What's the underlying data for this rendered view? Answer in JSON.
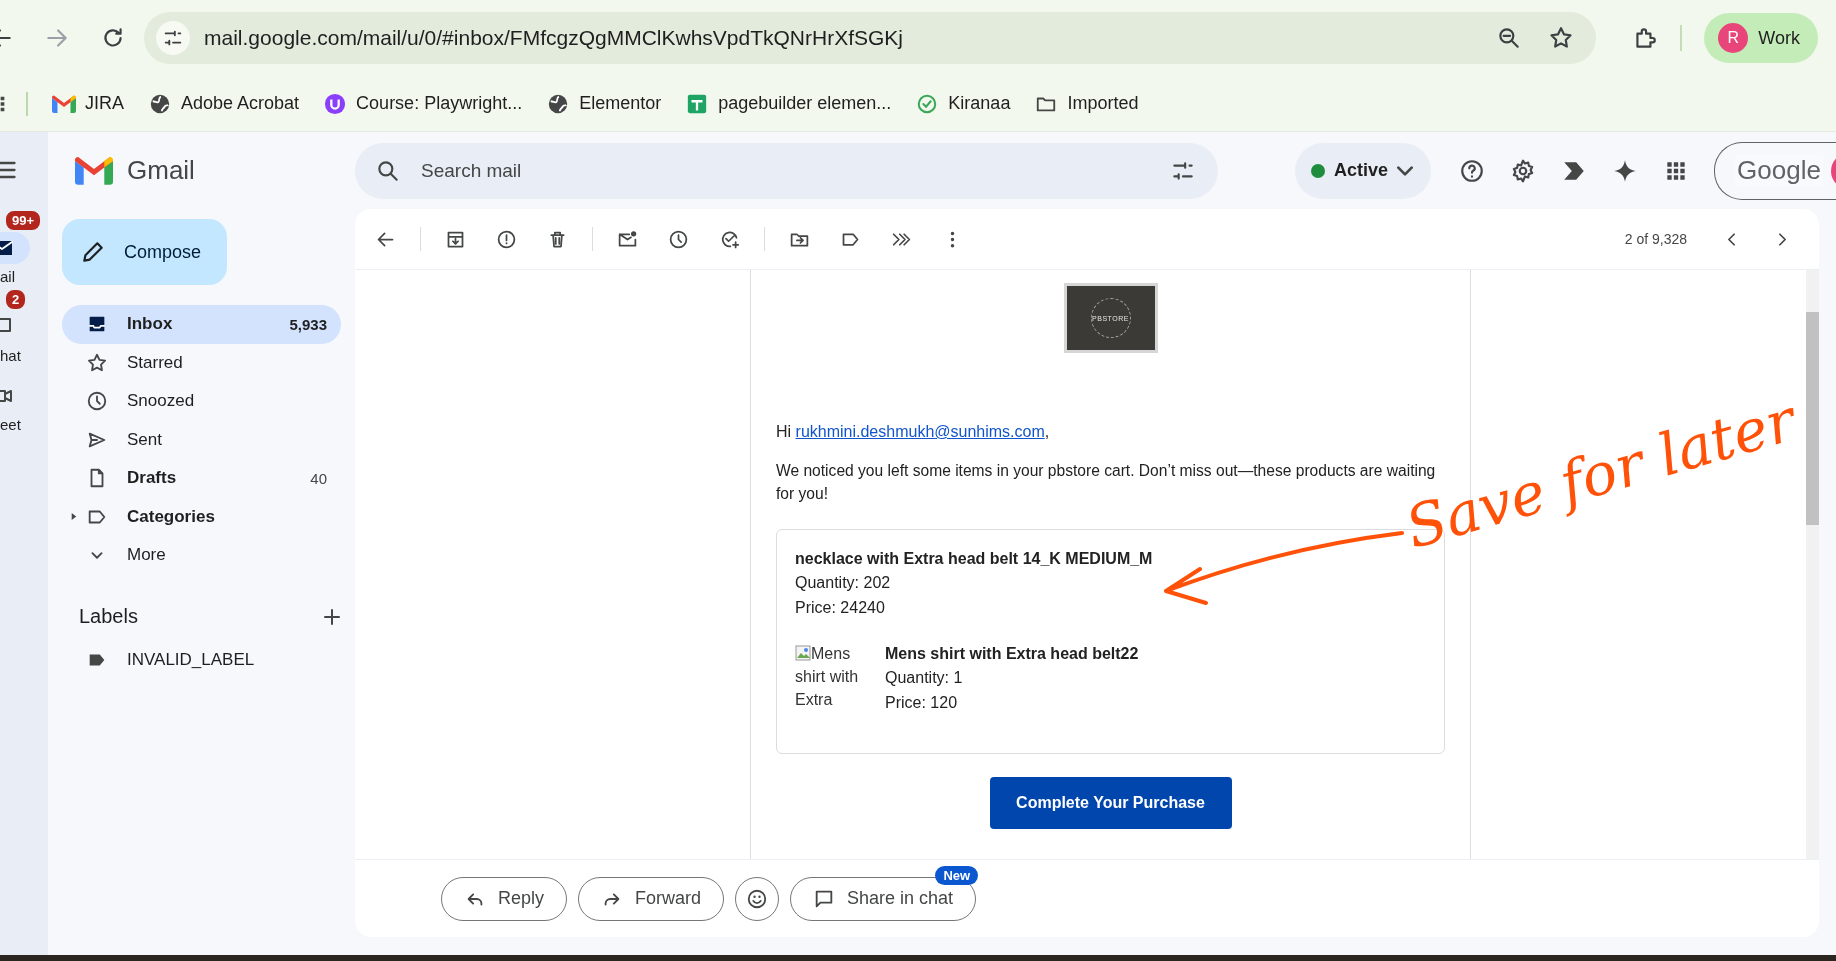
{
  "browser": {
    "url": "mail.google.com/mail/u/0/#inbox/FMfcgzQgMMClKwhsVpdTkQNrHrXfSGKj",
    "profile": {
      "initial": "R",
      "label": "Work"
    }
  },
  "bookmarks": [
    {
      "label": "JIRA",
      "kind": "mail"
    },
    {
      "label": "Adobe Acrobat",
      "kind": "globe"
    },
    {
      "label": "Course: Playwright...",
      "kind": "badge"
    },
    {
      "label": "Elementor",
      "kind": "globe"
    },
    {
      "label": "pagebuilder elemen...",
      "kind": "sheet"
    },
    {
      "label": "Kiranaa",
      "kind": "check"
    },
    {
      "label": "Imported",
      "kind": "folder"
    }
  ],
  "rail": [
    {
      "label": "ail",
      "badge": "99+",
      "kind": "mail",
      "selected": true
    },
    {
      "label": "hat",
      "badge": "2",
      "kind": "chat",
      "selected": false
    },
    {
      "label": "eet",
      "kind": "video",
      "selected": false
    }
  ],
  "app": {
    "name": "Gmail"
  },
  "compose": "Compose",
  "folders": [
    {
      "label": "Inbox",
      "count": "5,933",
      "kind": "inbox",
      "selected": true,
      "unread": true
    },
    {
      "label": "Starred",
      "kind": "starred",
      "selected": false,
      "unread": false
    },
    {
      "label": "Snoozed",
      "kind": "snoozed",
      "selected": false,
      "unread": false
    },
    {
      "label": "Sent",
      "kind": "sent",
      "selected": false,
      "unread": false
    },
    {
      "label": "Drafts",
      "count": "40",
      "kind": "drafts",
      "selected": false,
      "unread": true
    },
    {
      "label": "Categories",
      "kind": "categories",
      "expanded": false,
      "selected": false,
      "unread": true
    },
    {
      "label": "More",
      "kind": "more",
      "selected": false,
      "unread": false
    }
  ],
  "labels": {
    "title": "Labels",
    "items": [
      {
        "label": "INVALID_LABEL"
      }
    ]
  },
  "search": {
    "placeholder": "Search mail"
  },
  "status": {
    "label": "Active"
  },
  "account": {
    "logo": "Google"
  },
  "pager": "2 of 9,328",
  "email": {
    "logo": "PBSTORE",
    "greeting": "Hi",
    "email_link": "rukhmini.deshmukh@sunhims.com",
    "greeting_end": ",",
    "message": "We noticed you left some items in your pbstore cart. Don’t miss out—these products are waiting for you!",
    "items": [
      {
        "name": "necklace with Extra head belt 14_K MEDIUM_M",
        "quantity": "Quantity: 202",
        "price": "Price: 24240"
      },
      {
        "image_alt": "Mens shirt with Extra",
        "name": "Mens shirt with Extra head belt22",
        "quantity": "Quantity: 1",
        "price": "Price: 120"
      }
    ],
    "button": "Complete Your Purchase"
  },
  "actions": [
    {
      "label": "Reply",
      "kind": "reply"
    },
    {
      "label": "Forward",
      "kind": "forward"
    },
    {
      "kind": "emoji"
    },
    {
      "label": "Share in chat",
      "kind": "chat",
      "badge": "New"
    }
  ],
  "annotation": {
    "text": "Save for later"
  }
}
